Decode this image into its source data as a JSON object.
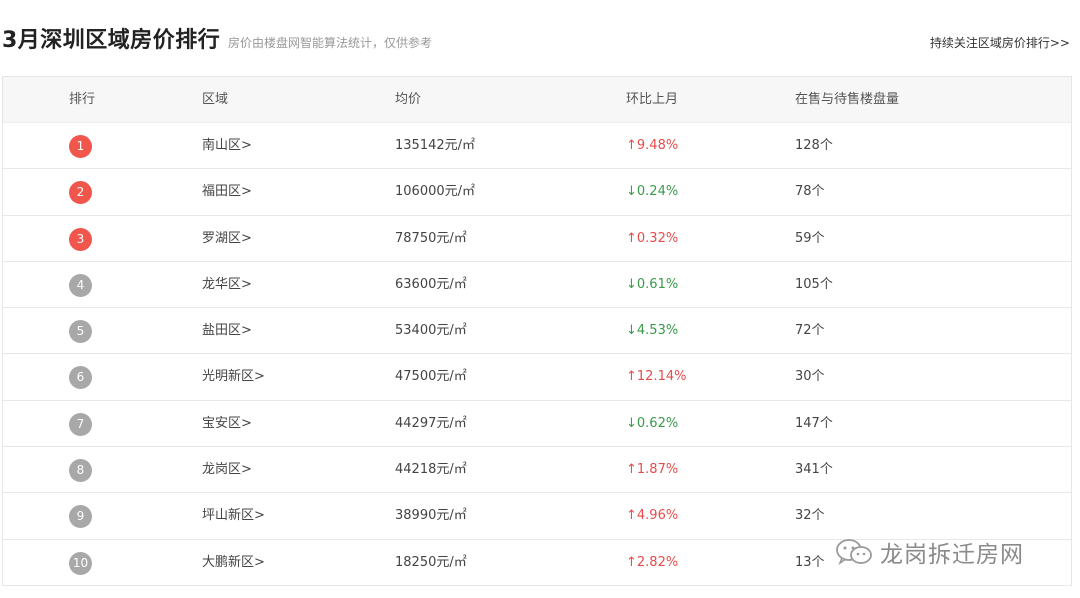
{
  "header": {
    "title": "3月深圳区域房价排行",
    "subtitle": "房价由楼盘网智能算法统计，仅供参考",
    "follow_link": "持续关注区域房价排行>>"
  },
  "table": {
    "columns": [
      "排行",
      "区域",
      "均价",
      "环比上月",
      "在售与待售楼盘量"
    ],
    "rows": [
      {
        "rank": "1",
        "area": "南山区>",
        "price": "135142元/㎡",
        "change": "↑9.48%",
        "direction": "up",
        "count": "128个"
      },
      {
        "rank": "2",
        "area": "福田区>",
        "price": "106000元/㎡",
        "change": "↓0.24%",
        "direction": "down",
        "count": "78个"
      },
      {
        "rank": "3",
        "area": "罗湖区>",
        "price": "78750元/㎡",
        "change": "↑0.32%",
        "direction": "up",
        "count": "59个"
      },
      {
        "rank": "4",
        "area": "龙华区>",
        "price": "63600元/㎡",
        "change": "↓0.61%",
        "direction": "down",
        "count": "105个"
      },
      {
        "rank": "5",
        "area": "盐田区>",
        "price": "53400元/㎡",
        "change": "↓4.53%",
        "direction": "down",
        "count": "72个"
      },
      {
        "rank": "6",
        "area": "光明新区>",
        "price": "47500元/㎡",
        "change": "↑12.14%",
        "direction": "up",
        "count": "30个"
      },
      {
        "rank": "7",
        "area": "宝安区>",
        "price": "44297元/㎡",
        "change": "↓0.62%",
        "direction": "down",
        "count": "147个"
      },
      {
        "rank": "8",
        "area": "龙岗区>",
        "price": "44218元/㎡",
        "change": "↑1.87%",
        "direction": "up",
        "count": "341个"
      },
      {
        "rank": "9",
        "area": "坪山新区>",
        "price": "38990元/㎡",
        "change": "↑4.96%",
        "direction": "up",
        "count": "32个"
      },
      {
        "rank": "10",
        "area": "大鹏新区>",
        "price": "18250元/㎡",
        "change": "↑2.82%",
        "direction": "up",
        "count": "13个"
      }
    ]
  },
  "watermark": {
    "text": "龙岗拆迁房网",
    "icon": "wechat-icon"
  },
  "colors": {
    "rank_top": "#f0564c",
    "rank_other": "#a8a8a8",
    "up": "#e64c4c",
    "down": "#3a9a4a"
  }
}
